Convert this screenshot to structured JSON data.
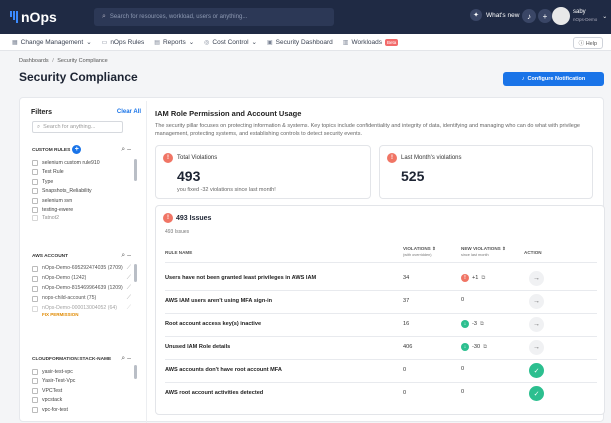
{
  "app": {
    "brand": "nOps"
  },
  "topbar": {
    "search_placeholder": "Search for resources, workload, users or anything...",
    "whats_new": "What's new",
    "user_name": "saby",
    "user_org": "nOps-Demo"
  },
  "nav": {
    "items": [
      {
        "label": "Change Management",
        "icon": "calendar-icon",
        "chevron": "⌄"
      },
      {
        "label": "nOps Rules",
        "icon": "rules-icon",
        "chevron": ""
      },
      {
        "label": "Reports",
        "icon": "report-icon",
        "chevron": "⌄"
      },
      {
        "label": "Cost Control",
        "icon": "dollar-icon",
        "chevron": "⌄"
      },
      {
        "label": "Security Dashboard",
        "icon": "lock-icon",
        "chevron": ""
      },
      {
        "label": "Workloads",
        "icon": "workload-icon",
        "chevron": ""
      }
    ],
    "beta_badge": "Beta",
    "help": "Help"
  },
  "breadcrumb": {
    "root": "Dashboards",
    "separator": "/",
    "current": "Security Compliance"
  },
  "page": {
    "title": "Security Compliance",
    "configure_button": "Configure Notification"
  },
  "filters": {
    "title": "Filters",
    "clear_all": "Clear All",
    "search_placeholder": "Search for anything...",
    "custom_rules": {
      "header": "CUSTOM RULES",
      "items": [
        "selenium custom rule910",
        "Test Rule",
        "Type",
        "Snapshots_Reliability",
        "selenium svn",
        "testing-ewere",
        "Tatnot2"
      ]
    },
    "aws_account": {
      "header": "AWS ACCOUNT",
      "items": [
        {
          "label": "nOps-Demo-695292474035 (2709)"
        },
        {
          "label": "nOps-Demo (1242)"
        },
        {
          "label": "nOps-Demo-815469964639 (1209)"
        },
        {
          "label": "nops-child-account (75)"
        },
        {
          "label": "nOps-Demo-000013004052 (64)",
          "note": "FIX PERMISSION"
        }
      ]
    },
    "cloudformation": {
      "header": "CLOUDFORMATION:STACK-NAME",
      "items": [
        "yasir-test-vpc",
        "Yasir-Test-Vpc",
        "VPCTest",
        "vpcstack",
        "vpc-for-test"
      ]
    }
  },
  "content": {
    "title": "IAM Role Permission and Account Usage",
    "description": "The security pillar focuses on protecting information & systems. Key topics include confidentiality and integrity of data, identifying and managing who can do what with privilege management, protecting systems, and establishing controls to detect security events."
  },
  "total_violations": {
    "label": "Total Violations",
    "value": "493",
    "note": "you fixed -32 violations since last month!"
  },
  "last_month": {
    "label": "Last Month's violations",
    "value": "525"
  },
  "issues": {
    "title": "493 Issues",
    "subtitle": "493 Issues",
    "columns": {
      "rule_name": "RULE NAME",
      "violations": "VIOLATIONS ⇕",
      "violations_sub": "(with overridden)",
      "new_violations": "NEW VIOLATIONS ⇕",
      "new_violations_sub": "since last month",
      "action": "ACTION"
    },
    "rows": [
      {
        "rule": "Users have not been granted least privileges in AWS IAM",
        "violations": "34",
        "change": "+1",
        "status": "up",
        "action_icon": "→",
        "action_state": "arrow"
      },
      {
        "rule": "AWS IAM users aren't using MFA sign-in",
        "violations": "37",
        "change": "0",
        "status": "none",
        "action_icon": "→",
        "action_state": "arrow"
      },
      {
        "rule": "Root account access key(s) inactive",
        "violations": "16",
        "change": "-3",
        "status": "down",
        "action_icon": "→",
        "action_state": "arrow"
      },
      {
        "rule": "Unused IAM Role details",
        "violations": "406",
        "change": "-30",
        "status": "down",
        "action_icon": "→",
        "action_state": "arrow"
      },
      {
        "rule": "AWS accounts don't have root account MFA",
        "violations": "0",
        "change": "0",
        "status": "none",
        "action_icon": "✓",
        "action_state": "ok"
      },
      {
        "rule": "AWS root account activities detected",
        "violations": "0",
        "change": "0",
        "status": "none",
        "action_icon": "✓",
        "action_state": "ok"
      }
    ]
  },
  "colors": {
    "topbar": "#1f2a44",
    "accent": "#1a74e8",
    "alert": "#f07565",
    "success": "#2cbf8f"
  }
}
